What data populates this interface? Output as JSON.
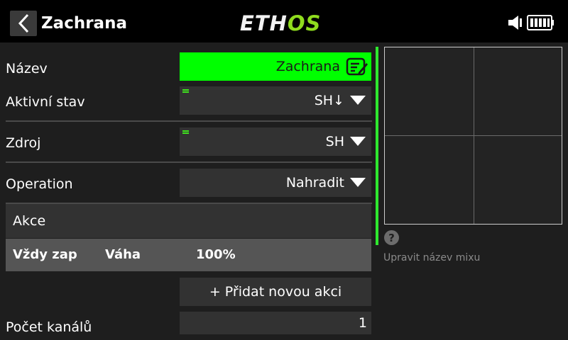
{
  "header": {
    "title": "Zachrana",
    "logo_part1": "ETH",
    "logo_part2": "OS"
  },
  "form": {
    "name": {
      "label": "Název",
      "value": "Zachrana"
    },
    "active_state": {
      "label": "Aktivní stav",
      "value": "SH↓"
    },
    "source": {
      "label": "Zdroj",
      "value": "SH"
    },
    "operation": {
      "label": "Operation",
      "value": "Nahradit"
    },
    "actions": {
      "label": "Akce",
      "rows": [
        {
          "mode": "Vždy zap",
          "weight_label": "Váha",
          "weight_value": "100%"
        }
      ]
    },
    "add_action_label": "+ Přidat novou akci",
    "channel_count": {
      "label": "Počet kanálů",
      "value": "1"
    }
  },
  "help": {
    "icon": "?",
    "text": "Upravit název mixu"
  },
  "colors": {
    "accent_green": "#00ff00",
    "logo_green": "#8fdc1e"
  }
}
